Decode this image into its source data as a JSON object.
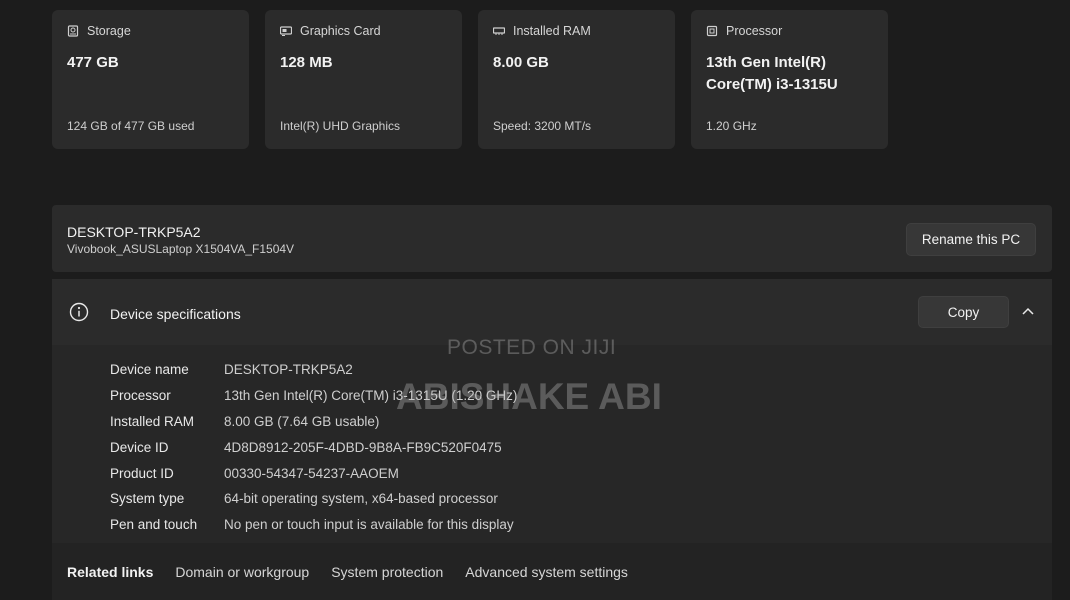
{
  "cards": [
    {
      "icon": "storage-icon",
      "label": "Storage",
      "value": "477 GB",
      "sub": "124 GB of 477 GB used"
    },
    {
      "icon": "graphics-card-icon",
      "label": "Graphics Card",
      "value": "128 MB",
      "sub": "Intel(R) UHD Graphics"
    },
    {
      "icon": "ram-icon",
      "label": "Installed RAM",
      "value": "8.00 GB",
      "sub": "Speed: 3200 MT/s"
    },
    {
      "icon": "processor-icon",
      "label": "Processor",
      "value": "13th Gen Intel(R) Core(TM) i3-1315U",
      "sub": "1.20 GHz"
    }
  ],
  "pc": {
    "name": "DESKTOP-TRKP5A2",
    "model": "Vivobook_ASUSLaptop X1504VA_F1504V",
    "rename_label": "Rename this PC"
  },
  "specs": {
    "title": "Device specifications",
    "copy_label": "Copy",
    "rows": [
      {
        "label": "Device name",
        "value": "DESKTOP-TRKP5A2"
      },
      {
        "label": "Processor",
        "value": "13th Gen Intel(R) Core(TM) i3-1315U (1.20 GHz)"
      },
      {
        "label": "Installed RAM",
        "value": "8.00 GB (7.64 GB usable)"
      },
      {
        "label": "Device ID",
        "value": "4D8D8912-205F-4DBD-9B8A-FB9C520F0475"
      },
      {
        "label": "Product ID",
        "value": "00330-54347-54237-AAOEM"
      },
      {
        "label": "System type",
        "value": "64-bit operating system, x64-based processor"
      },
      {
        "label": "Pen and touch",
        "value": "No pen or touch input is available for this display"
      }
    ]
  },
  "related": {
    "label": "Related links",
    "links": [
      "Domain or workgroup",
      "System protection",
      "Advanced system settings"
    ]
  },
  "watermark": {
    "line1": "POSTED ON JIJI",
    "line2": "ABISHAKE ABI"
  }
}
